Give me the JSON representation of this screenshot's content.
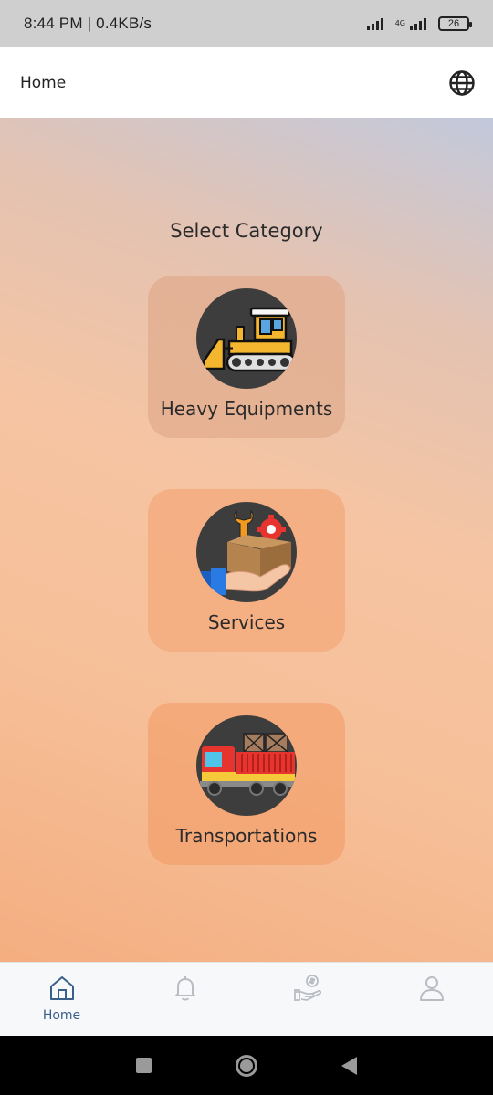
{
  "status_bar": {
    "time": "8:44 PM | 0.4KB/s",
    "network_top": "4G",
    "network_bottom": "4G",
    "battery": "26"
  },
  "header": {
    "title": "Home",
    "language_icon": "globe-icon"
  },
  "main": {
    "section_title": "Select Category",
    "categories": [
      {
        "label": "Heavy Equipments",
        "icon": "bulldozer-icon"
      },
      {
        "label": "Services",
        "icon": "service-hand-icon"
      },
      {
        "label": "Transportations",
        "icon": "truck-icon"
      }
    ]
  },
  "bottom_nav": {
    "items": [
      {
        "label": "Home",
        "icon": "home-icon",
        "active": true
      },
      {
        "label": "",
        "icon": "bell-icon",
        "active": false
      },
      {
        "label": "",
        "icon": "payment-hand-icon",
        "active": false
      },
      {
        "label": "",
        "icon": "user-icon",
        "active": false
      }
    ],
    "active_color": "#3a5f8a",
    "inactive_color": "#b9bcc2"
  }
}
